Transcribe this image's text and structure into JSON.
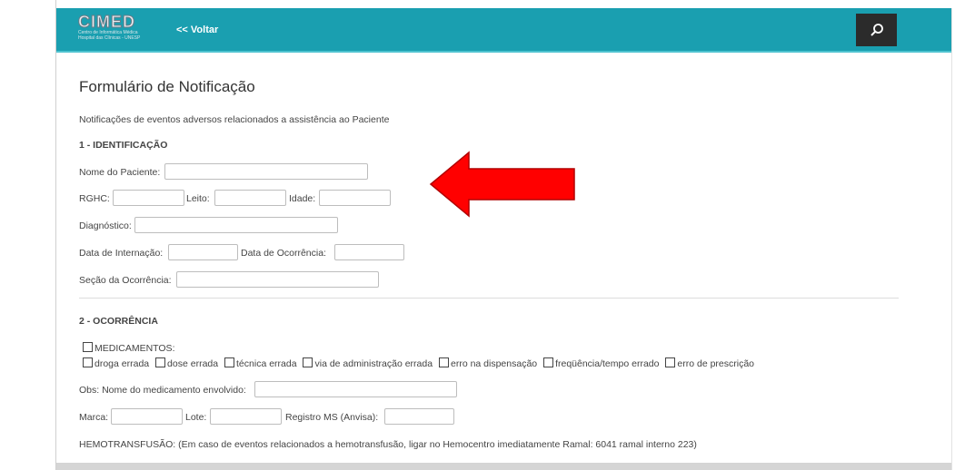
{
  "header": {
    "logo_text": "CIMED",
    "logo_sub1": "Centro de Informática Médica",
    "logo_sub2": "Hospital das Clínicas - UNESP",
    "back_label": "<< Voltar",
    "search_icon": "search-icon"
  },
  "form": {
    "title": "Formulário de Notificação",
    "subtitle": "Notificações de eventos adversos relacionados a assistência ao Paciente",
    "section1": "1 - IDENTIFICAÇÃO",
    "nome_paciente": "Nome do Paciente:",
    "rghc": "RGHC:",
    "leito": "Leito:",
    "idade": "Idade:",
    "diagnostico": "Diagnóstico:",
    "data_internacao": "Data de Internação:",
    "data_ocorrencia": "Data de Ocorrência:",
    "secao_ocorrencia": "Seção da Ocorrência:",
    "section2": "2 - OCORRÊNCIA",
    "medicamentos": "MEDICAMENTOS:",
    "med_options": [
      "droga errada",
      "dose errada",
      "técnica errada",
      "via de administração errada",
      "erro na dispensação",
      "freqüência/tempo errado",
      "erro de prescrição"
    ],
    "obs_medicamento": "Obs: Nome do medicamento envolvido:",
    "marca": "Marca:",
    "lote": "Lote:",
    "registro_ms": "Registro MS (Anvisa):",
    "hemotransfusao": "HEMOTRANSFUSÃO: (Em caso de eventos relacionados a hemotransfusão, ligar no Hemocentro imediatamente Ramal: 6041 ramal interno 223)"
  },
  "colors": {
    "header_bg": "#1a9fb0",
    "search_bg": "#2b2b2b",
    "arrow": "#ff0000"
  }
}
